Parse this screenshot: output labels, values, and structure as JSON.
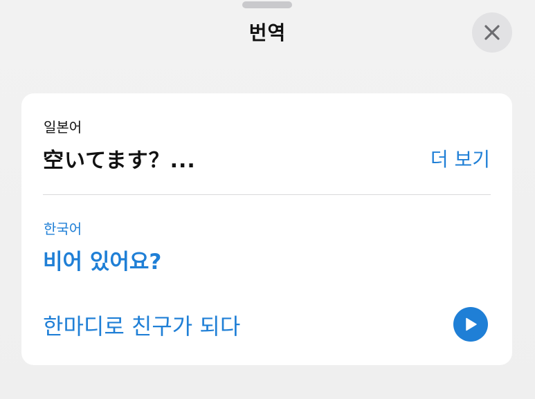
{
  "sheet": {
    "title": "번역",
    "close_icon": "close-icon"
  },
  "translation": {
    "source_language": "일본어",
    "source_text": "空いてます？...",
    "more_label": "더 보기",
    "target_language": "한국어",
    "target_text": "비어 있어요?"
  },
  "promo": {
    "link_text": "한마디로 친구가 되다",
    "play_icon": "play-icon"
  },
  "colors": {
    "accent": "#1f7fd6",
    "background": "#efefef",
    "card": "#ffffff",
    "close_button_bg": "#e2e2e4"
  }
}
